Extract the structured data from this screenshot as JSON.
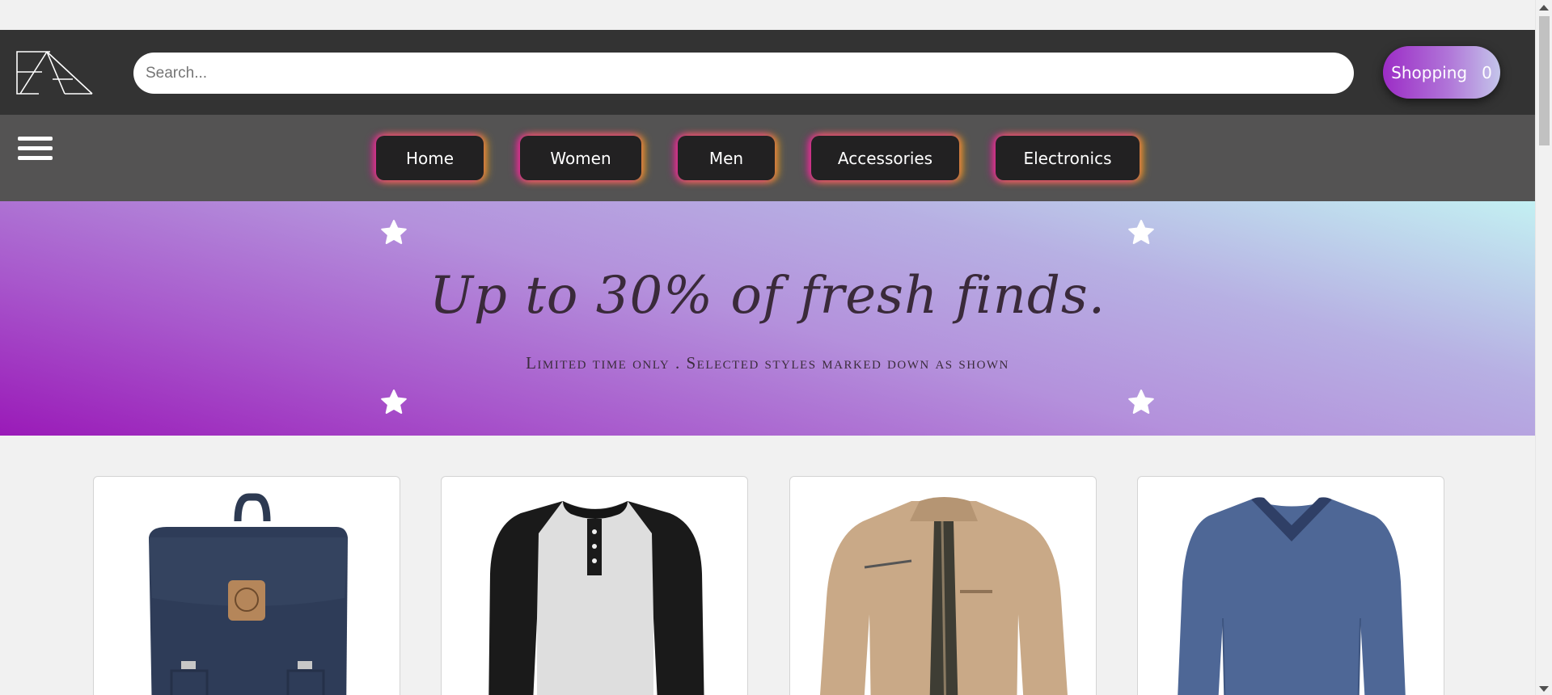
{
  "header": {
    "logo_alt": "EA",
    "search_placeholder": "Search...",
    "cart_label": "Shopping",
    "cart_count": "0",
    "cart_gradient": [
      "#9c2cc6",
      "#c4c5ea"
    ]
  },
  "nav": {
    "items": [
      {
        "label": "Home"
      },
      {
        "label": "Women"
      },
      {
        "label": "Men"
      },
      {
        "label": "Accessories"
      },
      {
        "label": "Electronics"
      }
    ],
    "glow_colors": [
      "#e614aa",
      "#f0aa14"
    ]
  },
  "hero": {
    "title": "Up to 30% of fresh finds.",
    "subtitle": "Limited time only . Selected styles marked down as shown",
    "gradient": [
      "#9a1ab8",
      "#c3f0f2"
    ]
  },
  "products": [
    {
      "name": "navy-backpack",
      "icon": "backpack-icon"
    },
    {
      "name": "raglan-henley-shirt",
      "icon": "henley-shirt-icon"
    },
    {
      "name": "khaki-jacket",
      "icon": "jacket-icon"
    },
    {
      "name": "blue-vneck-sweater",
      "icon": "sweater-icon"
    }
  ]
}
